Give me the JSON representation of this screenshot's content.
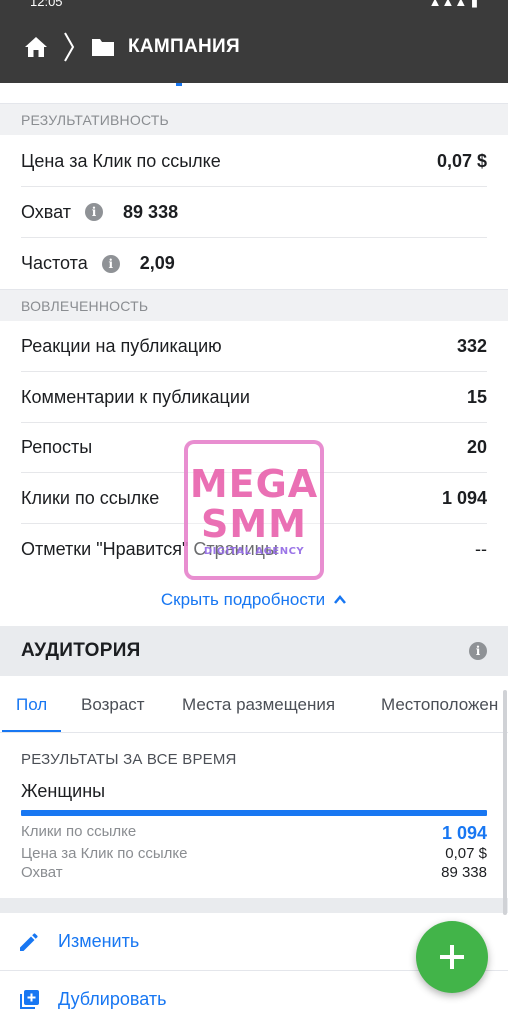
{
  "status_bar": {
    "time": "12:05",
    "right": "▲▲▲ ▮"
  },
  "header": {
    "title": "КАМПАНИЯ",
    "icons": [
      "home-icon",
      "chevron-right-icon",
      "folder-icon"
    ]
  },
  "performance": {
    "section_title": "РЕЗУЛЬТАТИВНОСТЬ",
    "cpc": {
      "label": "Цена за Клик по ссылке",
      "value": "0,07 $"
    },
    "reach": {
      "label": "Охват",
      "value": "89 338"
    },
    "frequency": {
      "label": "Частота",
      "value": "2,09"
    }
  },
  "engagement": {
    "section_title": "ВОВЛЕЧЕННОСТЬ",
    "rows": [
      {
        "label": "Реакции на публикацию",
        "value": "332"
      },
      {
        "label": "Комментарии к публикации",
        "value": "15"
      },
      {
        "label": "Репосты",
        "value": "20"
      },
      {
        "label": "Клики по ссылке",
        "value": "1 094"
      },
      {
        "label": "Отметки \"Нравится\" Страницы",
        "value": "--"
      }
    ]
  },
  "hide_details": "Скрыть подробности",
  "audience": {
    "title": "АУДИТОРИЯ",
    "tabs": [
      "Пол",
      "Возраст",
      "Места размещения",
      "Местоположен"
    ],
    "active_tab": "Пол",
    "results_caption": "РЕЗУЛЬТАТЫ ЗА ВСЕ ВРЕМЯ",
    "gender": "Женщины",
    "share_of_total": 1.0,
    "stats": [
      {
        "label": "Клики по ссылке",
        "value": "1 094"
      },
      {
        "label": "Цена за Клик по ссылке",
        "value": "0,07 $"
      },
      {
        "label": "Охват",
        "value": "89 338"
      }
    ]
  },
  "actions": {
    "edit": "Изменить",
    "duplicate": "Дублировать"
  },
  "watermark": {
    "line1": "MEGA",
    "line2": "SMM",
    "line3": "DIGITAL AGENCY"
  },
  "colors": {
    "accent": "#1877f2",
    "header_bg": "#3b3b3b",
    "fab": "#42b449",
    "section_bg": "#f0f1f3"
  }
}
